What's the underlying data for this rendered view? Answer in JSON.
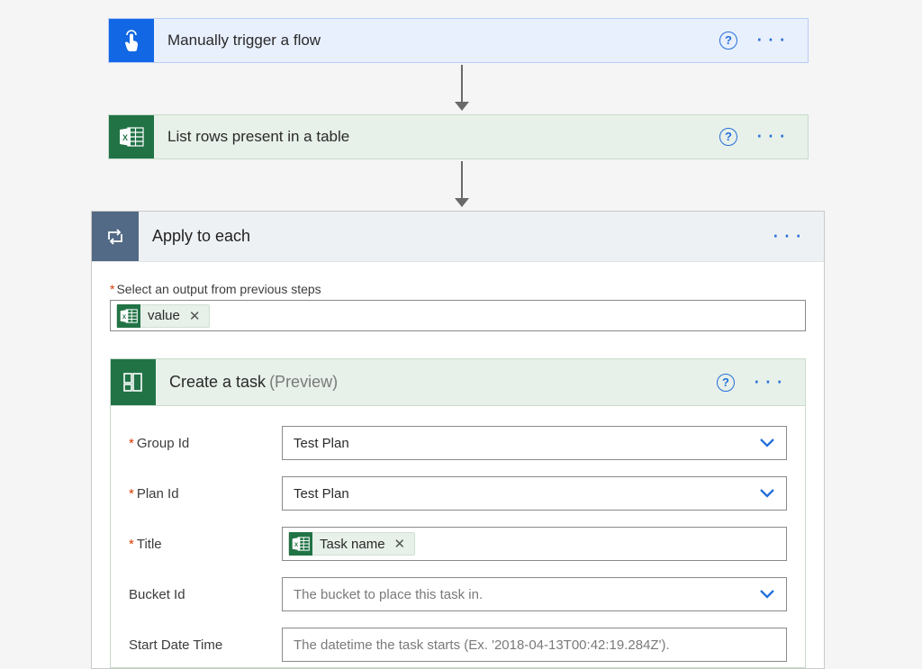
{
  "trigger": {
    "title": "Manually trigger a flow"
  },
  "listRows": {
    "title": "List rows present in a table"
  },
  "applyToEach": {
    "title": "Apply to each",
    "selectLabel": "Select an output from previous steps",
    "selectedToken": "value"
  },
  "createTask": {
    "title": "Create a task",
    "suffix": "(Preview)",
    "fields": {
      "groupId": {
        "label": "Group Id",
        "required": true,
        "value": "Test Plan"
      },
      "planId": {
        "label": "Plan Id",
        "required": true,
        "value": "Test Plan"
      },
      "title": {
        "label": "Title",
        "required": true,
        "tokenValue": "Task name"
      },
      "bucketId": {
        "label": "Bucket Id",
        "required": false,
        "placeholder": "The bucket to place this task in."
      },
      "startDateTime": {
        "label": "Start Date Time",
        "required": false,
        "placeholder": "The datetime the task starts (Ex. '2018-04-13T00:42:19.284Z')."
      }
    }
  },
  "glyphs": {
    "remove": "✕",
    "help": "?",
    "more": "···"
  }
}
